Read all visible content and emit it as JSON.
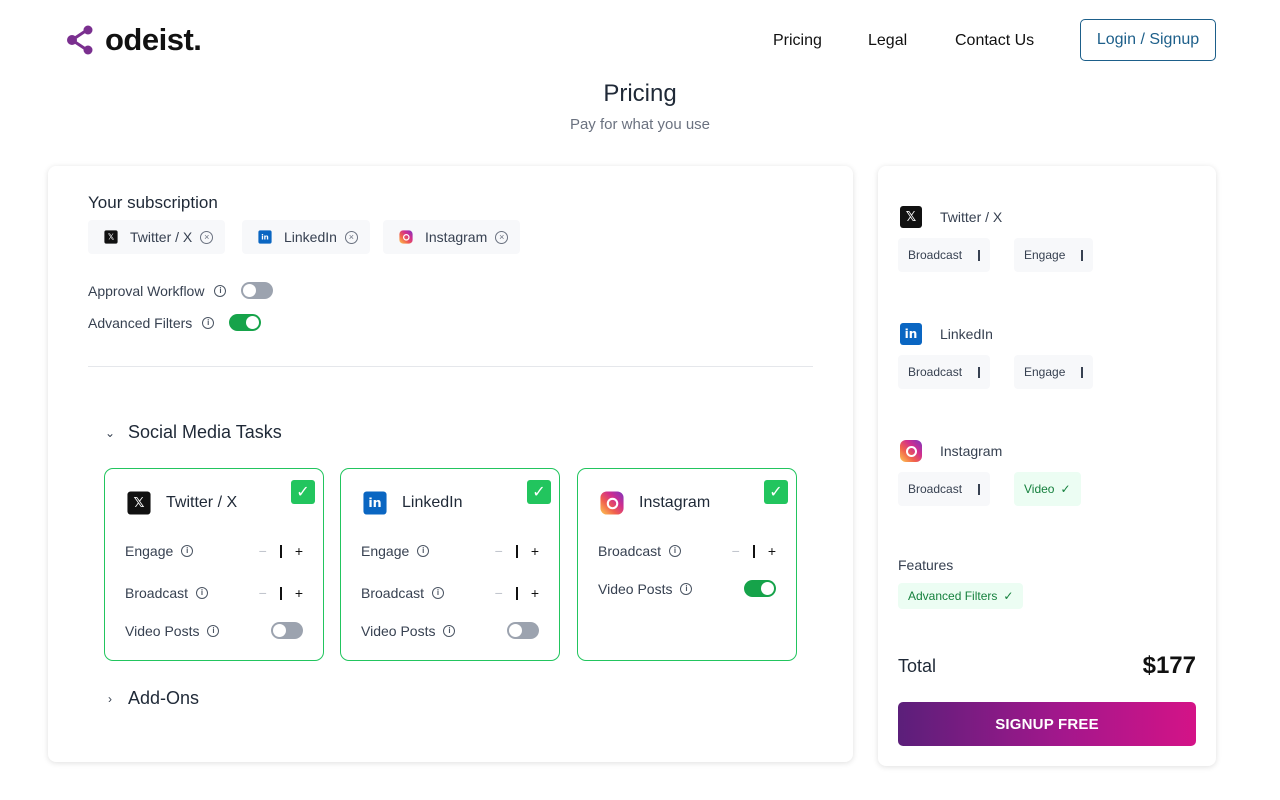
{
  "brand": {
    "name": "odeist."
  },
  "nav": {
    "pricing": "Pricing",
    "legal": "Legal",
    "contact": "Contact Us",
    "login": "Login / Signup"
  },
  "header": {
    "title": "Pricing",
    "subtitle": "Pay for what you use"
  },
  "subscription": {
    "title": "Your subscription",
    "chips": [
      "Twitter / X",
      "LinkedIn",
      "Instagram"
    ],
    "approval_label": "Approval Workflow",
    "approval_on": false,
    "filters_label": "Advanced Filters",
    "filters_on": true
  },
  "sections": {
    "tasks": "Social Media Tasks",
    "addons": "Add-Ons"
  },
  "cards": {
    "twitter": {
      "name": "Twitter / X",
      "engage": "Engage",
      "broadcast": "Broadcast",
      "video": "Video Posts",
      "video_on": false,
      "checked": true
    },
    "linkedin": {
      "name": "LinkedIn",
      "engage": "Engage",
      "broadcast": "Broadcast",
      "video": "Video Posts",
      "video_on": false,
      "checked": true
    },
    "instagram": {
      "name": "Instagram",
      "broadcast": "Broadcast",
      "video": "Video Posts",
      "video_on": true,
      "checked": true
    }
  },
  "summary": {
    "twitter": {
      "name": "Twitter / X",
      "tag1": "Broadcast",
      "tag2": "Engage"
    },
    "linkedin": {
      "name": "LinkedIn",
      "tag1": "Broadcast",
      "tag2": "Engage"
    },
    "instagram": {
      "name": "Instagram",
      "tag1": "Broadcast",
      "tag2": "Video"
    },
    "features_label": "Features",
    "feature": "Advanced Filters",
    "total_label": "Total",
    "total_value": "$177",
    "cta": "SIGNUP FREE"
  },
  "symbols": {
    "check": "✓",
    "plus": "+",
    "minus": "−",
    "remove": "×",
    "info": "i",
    "chevron_down": "⌄",
    "chevron_right": "›"
  },
  "colors": {
    "accent_green": "#22c55e",
    "toggle_on": "#16a34a",
    "link_blue": "#1d5f8a",
    "cta_start": "#5b1f7a",
    "cta_end": "#d41387"
  }
}
